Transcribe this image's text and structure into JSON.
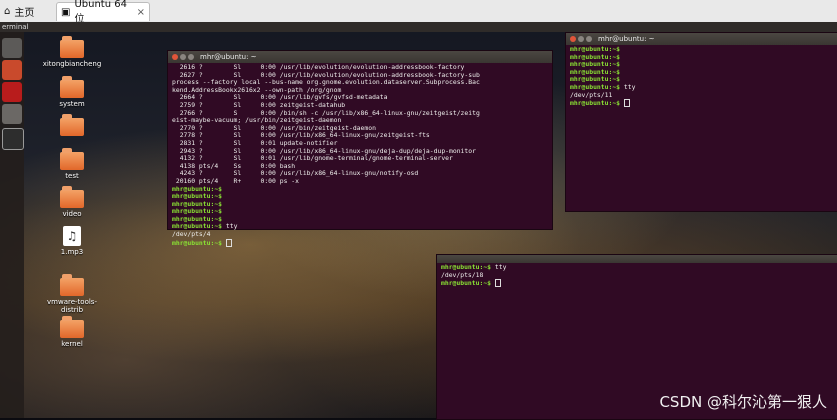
{
  "browser": {
    "tabs": [
      {
        "label": "主页",
        "icon": "home-icon"
      },
      {
        "label": "Ubuntu 64 位",
        "icon": "vm-icon",
        "close": "×"
      }
    ]
  },
  "topbar": {
    "title": "erminal"
  },
  "desktop_icons": [
    {
      "label": "xitongbiancheng",
      "type": "folder"
    },
    {
      "label": "system",
      "type": "folder"
    },
    {
      "label": "",
      "type": "folder"
    },
    {
      "label": "test",
      "type": "folder"
    },
    {
      "label": "video",
      "type": "folder"
    },
    {
      "label": "1.mp3",
      "type": "audio"
    },
    {
      "label": "vmware-tools-distrib",
      "type": "folder"
    },
    {
      "label": "kernel",
      "type": "folder"
    }
  ],
  "terminals": [
    {
      "title": "mhr@ubuntu: ~",
      "lines": [
        "  2616 ?        Sl     0:00 /usr/lib/evolution/evolution-addressbook-factory",
        "  2627 ?        Sl     0:00 /usr/lib/evolution/evolution-addressbook-factory-sub",
        "process --factory local --bus-name org.gnome.evolution.dataserver.Subprocess.Bac",
        "kend.AddressBookx2616x2 --own-path /org/gnom",
        "  2664 ?        Sl     0:00 /usr/lib/gvfs/gvfsd-metadata",
        "  2759 ?        Sl     0:00 zeitgeist-datahub",
        "  2766 ?        S      0:00 /bin/sh -c /usr/lib/x86_64-linux-gnu/zeitgeist/zeitg",
        "eist-maybe-vacuum; /usr/bin/zeitgeist-daemon",
        "  2770 ?        Sl     0:00 /usr/bin/zeitgeist-daemon",
        "  2778 ?        Sl     0:00 /usr/lib/x86_64-linux-gnu/zeitgeist-fts",
        "  2831 ?        Sl     0:01 update-notifier",
        "  2943 ?        Sl     0:00 /usr/lib/x86_64-linux-gnu/deja-dup/deja-dup-monitor",
        "  4132 ?        Sl     0:01 /usr/lib/gnome-terminal/gnome-terminal-server",
        "  4138 pts/4    Ss     0:00 bash",
        "  4243 ?        Sl     0:00 /usr/lib/x86_64-linux-gnu/notify-osd",
        " 20160 pts/4    R+     0:00 ps -x",
        "mhr@ubuntu:~$",
        "mhr@ubuntu:~$",
        "mhr@ubuntu:~$",
        "mhr@ubuntu:~$",
        "mhr@ubuntu:~$",
        "mhr@ubuntu:~$ tty",
        "/dev/pts/4",
        "mhr@ubuntu:~$"
      ]
    },
    {
      "title": "mhr@ubuntu: ~",
      "lines": [
        "mhr@ubuntu:~$",
        "mhr@ubuntu:~$",
        "mhr@ubuntu:~$",
        "mhr@ubuntu:~$",
        "mhr@ubuntu:~$",
        "mhr@ubuntu:~$ tty",
        "/dev/pts/11",
        "mhr@ubuntu:~$"
      ]
    },
    {
      "title": "",
      "lines": [
        "mhr@ubuntu:~$ tty",
        "/dev/pts/18",
        "mhr@ubuntu:~$"
      ]
    }
  ],
  "watermark": "CSDN @科尔沁第一狠人",
  "colors": {
    "terminal_bg": "#300a24",
    "prompt_green": "#8ae234"
  }
}
